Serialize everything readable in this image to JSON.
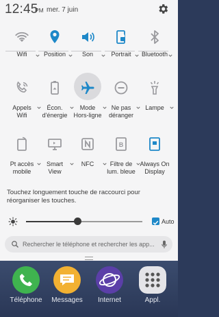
{
  "status": {
    "time": "12:45",
    "ampm": "PM",
    "date": "mer. 7 juin"
  },
  "tiles": [
    {
      "label": "Wifi",
      "icon": "wifi-icon",
      "active": false,
      "dropdown": true
    },
    {
      "label": "Position",
      "icon": "location-icon",
      "active": true,
      "dropdown": true
    },
    {
      "label": "Son",
      "icon": "sound-icon",
      "active": true,
      "dropdown": true
    },
    {
      "label": "Portrait",
      "icon": "portrait-rotation-icon",
      "active": true,
      "dropdown": true
    },
    {
      "label": "Bluetooth",
      "icon": "bluetooth-icon",
      "active": false,
      "dropdown": true
    },
    {
      "label": "Appels\nWifi",
      "icon": "wifi-calling-icon",
      "active": false,
      "dropdown": true
    },
    {
      "label": "Écon.\nd'énergie",
      "icon": "power-saving-icon",
      "active": false,
      "dropdown": true
    },
    {
      "label": "Mode\nHors-ligne",
      "icon": "airplane-icon",
      "active": true,
      "dropdown": true
    },
    {
      "label": "Ne pas\ndéranger",
      "icon": "do-not-disturb-icon",
      "active": false,
      "dropdown": true
    },
    {
      "label": "Lampe",
      "icon": "flashlight-icon",
      "active": false,
      "dropdown": true
    },
    {
      "label": "Pt accès\nmobile",
      "icon": "mobile-hotspot-icon",
      "active": false,
      "dropdown": true
    },
    {
      "label": "Smart\nView",
      "icon": "smart-view-icon",
      "active": false,
      "dropdown": true
    },
    {
      "label": "NFC",
      "icon": "nfc-icon",
      "active": false,
      "dropdown": true
    },
    {
      "label": "Filtre de\nlum. bleue",
      "icon": "blue-light-filter-icon",
      "active": false,
      "dropdown": true
    },
    {
      "label": "Always On\nDisplay",
      "icon": "always-on-display-icon",
      "active": true,
      "dropdown": false
    }
  ],
  "hint": "Touchez longuement touche de raccourci pour réorganiser les touches.",
  "brightness": {
    "level": 0.45,
    "auto_label": "Auto",
    "auto_checked": true
  },
  "search": {
    "placeholder": "Rechercher le téléphone et rechercher les app..."
  },
  "dock": [
    {
      "label": "Téléphone",
      "icon": "phone-icon",
      "color": "#3fb34f"
    },
    {
      "label": "Messages",
      "icon": "messages-icon",
      "color": "#f2b132"
    },
    {
      "label": "Internet",
      "icon": "internet-icon",
      "color": "#5b3fa8"
    },
    {
      "label": "Appl.",
      "icon": "apps-icon",
      "color": "#e4e4e8"
    }
  ],
  "colors": {
    "active": "#1e88c8",
    "inactive": "#9a9a9e",
    "panel": "#f5f5f6"
  }
}
